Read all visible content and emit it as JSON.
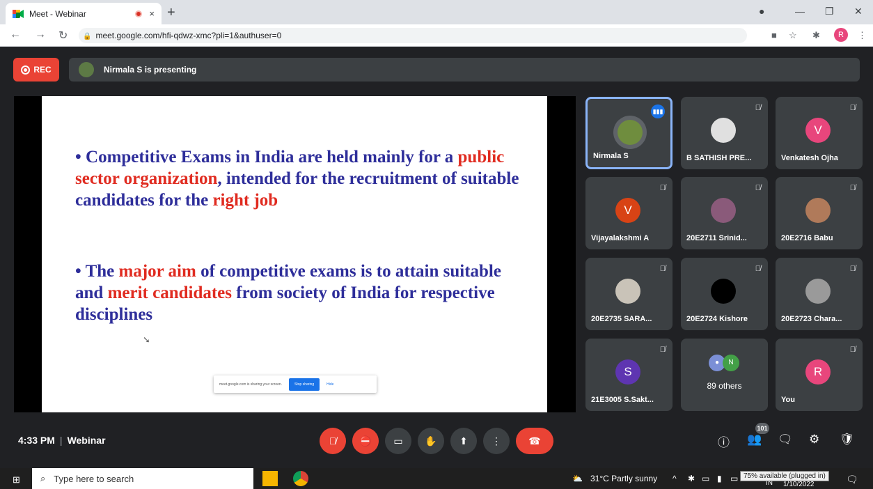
{
  "browser": {
    "tab_title": "Meet - Webinar",
    "close_glyph": "×",
    "new_tab_glyph": "+",
    "url": "meet.google.com/hfi-qdwz-xmc?pli=1&authuser=0",
    "profile_initial": "R"
  },
  "meet": {
    "rec_label": "REC",
    "presenting_text": "Nirmala S is presenting",
    "slide": {
      "bullet1": {
        "p1": "Competitive Exams in India are held mainly for a ",
        "p2": "public sector organization",
        "p3": ", intended for the recruitment of suitable candidates for the ",
        "p4": "right job"
      },
      "bullet2": {
        "p1": "The ",
        "p2": "major aim",
        "p3": " of competitive exams is to attain suitable and ",
        "p4": "merit candidates",
        "p5": " from society of India for respective disciplines"
      },
      "share_notice": "meet.google.com is sharing your screen.",
      "stop_sharing": "Stop sharing",
      "hide": "Hide"
    },
    "participants": [
      {
        "name": "Nirmala S"
      },
      {
        "name": "B SATHISH PRE..."
      },
      {
        "name": "Venkatesh Ojha",
        "initial": "V",
        "color": "#e8467c"
      },
      {
        "name": "Vijayalakshmi A",
        "initial": "V",
        "color": "#d84315"
      },
      {
        "name": "20E2711 Srinid..."
      },
      {
        "name": "20E2716 Babu"
      },
      {
        "name": "20E2735 SARA..."
      },
      {
        "name": "20E2724 Kishore"
      },
      {
        "name": "20E2723 Chara..."
      },
      {
        "name": "21E3005 S.Sakt...",
        "initial": "S",
        "color": "#5e35b1"
      },
      {
        "name": "89 others",
        "initial": "N"
      },
      {
        "name": "You",
        "initial": "R",
        "color": "#e8467c"
      }
    ],
    "bottom": {
      "time": "4:33 PM",
      "meeting_name": "Webinar",
      "people_count": "101"
    }
  },
  "taskbar": {
    "search_placeholder": "Type here to search",
    "weather": "31°C  Partly sunny",
    "battery_tooltip": "75% available (plugged in)",
    "lang": "IN",
    "date": "1/10/2022"
  }
}
